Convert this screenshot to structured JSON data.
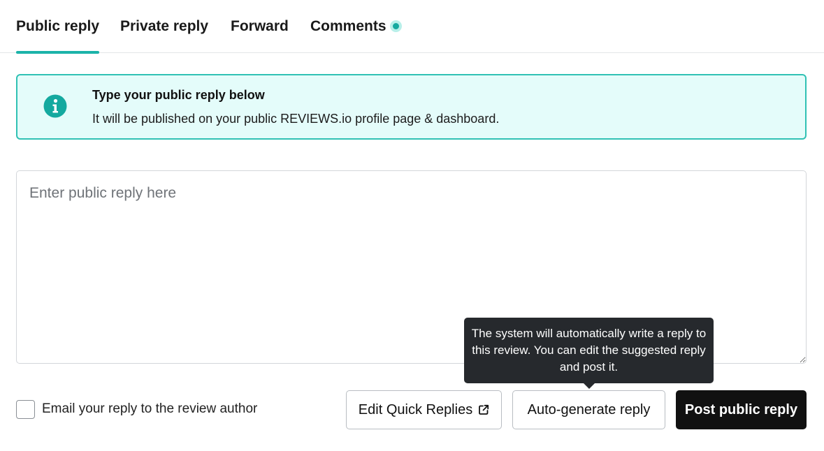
{
  "tabs": [
    {
      "label": "Public reply",
      "active": true
    },
    {
      "label": "Private reply",
      "active": false
    },
    {
      "label": "Forward",
      "active": false
    },
    {
      "label": "Comments",
      "active": false
    }
  ],
  "info": {
    "icon": "info-icon",
    "title": "Type your public reply below",
    "text": "It will be published on your public REVIEWS.io profile page & dashboard."
  },
  "reply": {
    "value": "",
    "placeholder": "Enter public reply here"
  },
  "tooltip": {
    "text": "The system will automatically write a reply to this review. You can edit the suggested reply and post it."
  },
  "email_option": {
    "label": "Email your reply to the review author",
    "checked": false
  },
  "buttons": {
    "quick_replies": "Edit Quick Replies",
    "quick_replies_icon": "external-link-icon",
    "auto_generate": "Auto-generate reply",
    "post": "Post public reply"
  },
  "colors": {
    "accent": "#1bb3a9",
    "info_background": "#e4fcfa",
    "tooltip_background": "#26292d",
    "primary_button": "#111111"
  }
}
